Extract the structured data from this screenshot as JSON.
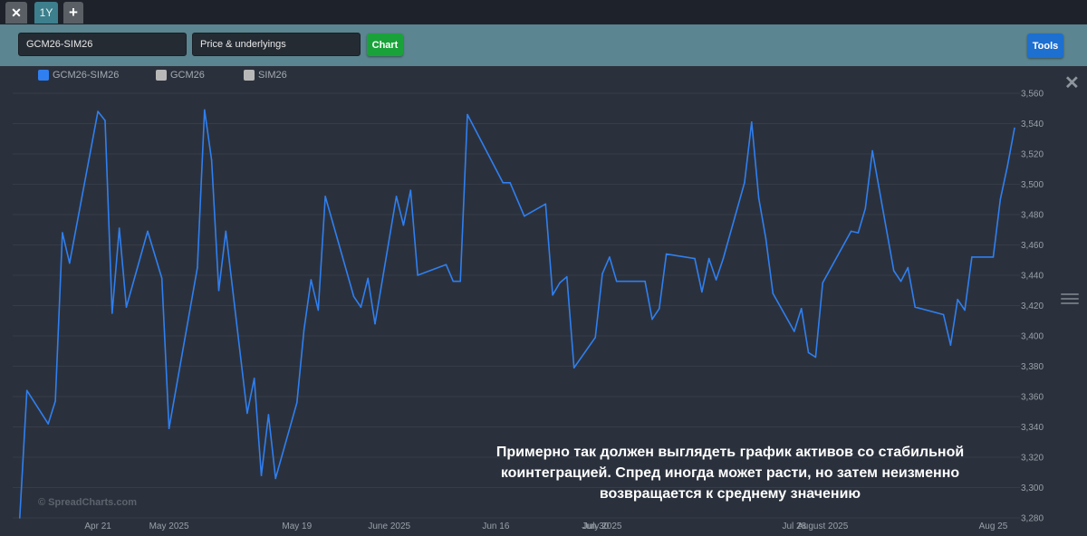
{
  "tabs": {
    "close_label": "✕",
    "period_label": "1Y",
    "add_label": "+"
  },
  "toolbar": {
    "symbol_value": "GCM26-SIM26",
    "mode_value": "Price & underlyings",
    "chart_button": "Chart",
    "tools_button": "Tools"
  },
  "legend": [
    {
      "label": "GCM26-SIM26",
      "color": "#2f7ff0"
    },
    {
      "label": "GCM26",
      "color": "#b8b8b8"
    },
    {
      "label": "SIM26",
      "color": "#b8b8b8"
    }
  ],
  "icons": {
    "close_chart": "close-icon",
    "menu": "hamburger-icon"
  },
  "annotation": "Примерно так должен выглядеть график активов со стабильной коинтеграцией. Спред иногда может расти, но затем неизменно возвращается к среднему значению",
  "watermark": "© SpreadCharts.com",
  "colors": {
    "background": "#2b313c",
    "line": "#2f7ff0",
    "grid": "#363d48",
    "toolbar": "#5b8590"
  },
  "chart_data": {
    "type": "line",
    "title": "",
    "xlabel": "",
    "ylabel": "",
    "ylim": [
      3280,
      3560
    ],
    "yticks": [
      3280,
      3300,
      3320,
      3340,
      3360,
      3380,
      3400,
      3420,
      3440,
      3460,
      3480,
      3500,
      3520,
      3540,
      3560
    ],
    "ytick_labels": [
      "3,280",
      "3,300",
      "3,320",
      "3,340",
      "3,360",
      "3,380",
      "3,400",
      "3,420",
      "3,440",
      "3,460",
      "3,480",
      "3,500",
      "3,520",
      "3,540",
      "3,560"
    ],
    "xlim": [
      "2025-04-09",
      "2025-08-28"
    ],
    "xticks": [
      {
        "date": "2025-04-21",
        "label": "Apr 21"
      },
      {
        "date": "2025-05-01",
        "label": "May 2025"
      },
      {
        "date": "2025-05-19",
        "label": "May 19"
      },
      {
        "date": "2025-06-01",
        "label": "June 2025"
      },
      {
        "date": "2025-06-16",
        "label": "Jun 16"
      },
      {
        "date": "2025-06-30",
        "label": "Jun 30"
      },
      {
        "date": "2025-07-01",
        "label": "July 2025"
      },
      {
        "date": "2025-07-28",
        "label": "Jul 28"
      },
      {
        "date": "2025-08-01",
        "label": "August 2025"
      },
      {
        "date": "2025-08-25",
        "label": "Aug 25"
      }
    ],
    "grid": true,
    "legend_position": "top-left",
    "series": [
      {
        "name": "GCM26-SIM26",
        "color": "#2f7ff0",
        "points": [
          [
            "2025-04-10",
            3280
          ],
          [
            "2025-04-11",
            3364
          ],
          [
            "2025-04-14",
            3342
          ],
          [
            "2025-04-15",
            3357
          ],
          [
            "2025-04-16",
            3468
          ],
          [
            "2025-04-17",
            3448
          ],
          [
            "2025-04-21",
            3548
          ],
          [
            "2025-04-22",
            3542
          ],
          [
            "2025-04-23",
            3415
          ],
          [
            "2025-04-24",
            3471
          ],
          [
            "2025-04-25",
            3419
          ],
          [
            "2025-04-28",
            3469
          ],
          [
            "2025-04-30",
            3438
          ],
          [
            "2025-05-01",
            3339
          ],
          [
            "2025-05-05",
            3445
          ],
          [
            "2025-05-06",
            3549
          ],
          [
            "2025-05-07",
            3516
          ],
          [
            "2025-05-08",
            3430
          ],
          [
            "2025-05-09",
            3469
          ],
          [
            "2025-05-12",
            3349
          ],
          [
            "2025-05-13",
            3372
          ],
          [
            "2025-05-14",
            3308
          ],
          [
            "2025-05-15",
            3348
          ],
          [
            "2025-05-16",
            3306
          ],
          [
            "2025-05-19",
            3356
          ],
          [
            "2025-05-20",
            3404
          ],
          [
            "2025-05-21",
            3437
          ],
          [
            "2025-05-22",
            3417
          ],
          [
            "2025-05-23",
            3492
          ],
          [
            "2025-05-27",
            3426
          ],
          [
            "2025-05-28",
            3419
          ],
          [
            "2025-05-29",
            3438
          ],
          [
            "2025-05-30",
            3408
          ],
          [
            "2025-06-02",
            3492
          ],
          [
            "2025-06-03",
            3473
          ],
          [
            "2025-06-04",
            3496
          ],
          [
            "2025-06-05",
            3440
          ],
          [
            "2025-06-09",
            3447
          ],
          [
            "2025-06-10",
            3436
          ],
          [
            "2025-06-11",
            3436
          ],
          [
            "2025-06-12",
            3546
          ],
          [
            "2025-06-16",
            3510
          ],
          [
            "2025-06-17",
            3501
          ],
          [
            "2025-06-18",
            3501
          ],
          [
            "2025-06-20",
            3479
          ],
          [
            "2025-06-23",
            3487
          ],
          [
            "2025-06-24",
            3427
          ],
          [
            "2025-06-25",
            3435
          ],
          [
            "2025-06-26",
            3439
          ],
          [
            "2025-06-27",
            3379
          ],
          [
            "2025-06-30",
            3399
          ],
          [
            "2025-07-01",
            3441
          ],
          [
            "2025-07-02",
            3452
          ],
          [
            "2025-07-03",
            3436
          ],
          [
            "2025-07-07",
            3436
          ],
          [
            "2025-07-08",
            3411
          ],
          [
            "2025-07-09",
            3418
          ],
          [
            "2025-07-10",
            3454
          ],
          [
            "2025-07-14",
            3451
          ],
          [
            "2025-07-15",
            3429
          ],
          [
            "2025-07-16",
            3451
          ],
          [
            "2025-07-17",
            3437
          ],
          [
            "2025-07-18",
            3451
          ],
          [
            "2025-07-21",
            3501
          ],
          [
            "2025-07-22",
            3541
          ],
          [
            "2025-07-23",
            3491
          ],
          [
            "2025-07-24",
            3464
          ],
          [
            "2025-07-25",
            3428
          ],
          [
            "2025-07-28",
            3403
          ],
          [
            "2025-07-29",
            3418
          ],
          [
            "2025-07-30",
            3389
          ],
          [
            "2025-07-31",
            3386
          ],
          [
            "2025-08-01",
            3435
          ],
          [
            "2025-08-05",
            3469
          ],
          [
            "2025-08-06",
            3468
          ],
          [
            "2025-08-07",
            3484
          ],
          [
            "2025-08-08",
            3522
          ],
          [
            "2025-08-11",
            3443
          ],
          [
            "2025-08-12",
            3436
          ],
          [
            "2025-08-13",
            3445
          ],
          [
            "2025-08-14",
            3419
          ],
          [
            "2025-08-18",
            3414
          ],
          [
            "2025-08-19",
            3394
          ],
          [
            "2025-08-20",
            3424
          ],
          [
            "2025-08-21",
            3417
          ],
          [
            "2025-08-22",
            3452
          ],
          [
            "2025-08-25",
            3452
          ],
          [
            "2025-08-26",
            3490
          ],
          [
            "2025-08-27",
            3512
          ],
          [
            "2025-08-28",
            3537
          ]
        ]
      }
    ]
  }
}
